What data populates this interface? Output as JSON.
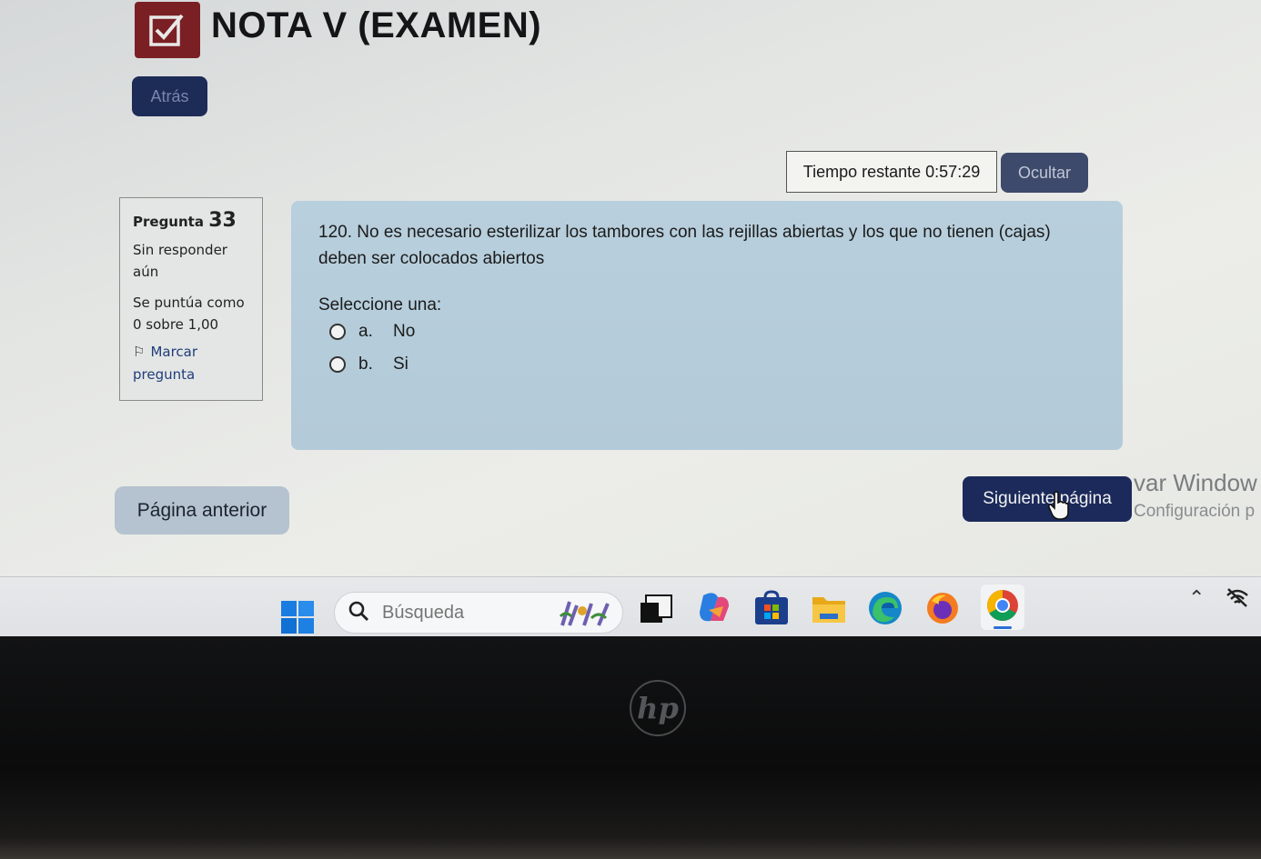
{
  "header": {
    "title": "NOTA V (EXAMEN)",
    "back_label": "Atrás"
  },
  "timer": {
    "label": "Tiempo restante 0:57:29",
    "hide_label": "Ocultar"
  },
  "question_info": {
    "label": "Pregunta",
    "number": "33",
    "status": "Sin responder aún",
    "grade": "Se puntúa como 0 sobre 1,00",
    "flag_label": "Marcar pregunta"
  },
  "question": {
    "text": "120. No es necesario esterilizar los tambores con las rejillas abiertas y los que no tienen (cajas) deben ser colocados abiertos",
    "prompt": "Seleccione una:",
    "options": [
      {
        "letter": "a.",
        "text": "No"
      },
      {
        "letter": "b.",
        "text": "Si"
      }
    ]
  },
  "navigation": {
    "prev_label": "Página anterior",
    "next_label": "Siguiente página"
  },
  "watermark": {
    "line1": "var Window",
    "line2": "Configuración p"
  },
  "taskbar": {
    "search_placeholder": "Búsqueda",
    "apps": [
      "task-view-icon",
      "copilot-icon",
      "store-icon",
      "file-explorer-icon",
      "edge-icon",
      "firefox-icon",
      "chrome-icon"
    ]
  },
  "colors": {
    "accent": "#1b2a5a",
    "question_bg": "#b8cfdd",
    "icon_bg": "#7a2024"
  },
  "brand": {
    "laptop_logo": "hp"
  }
}
